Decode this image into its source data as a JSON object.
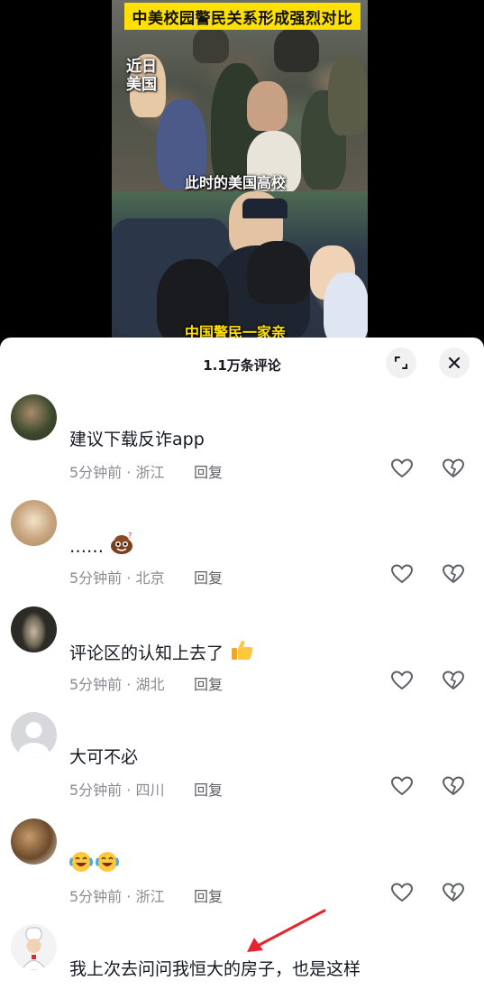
{
  "video": {
    "banner": "中美校园警民关系形成强烈对比",
    "caption_top_left": "近日美国",
    "caption_mid": "此时的美国高校",
    "caption_bottom": "中国警民一家亲"
  },
  "sheet": {
    "title": "1.1万条评论",
    "expand_icon": "expand-icon",
    "close_icon": "close-icon",
    "reply_label": "回复"
  },
  "comments": [
    {
      "text": "建议下载反诈app",
      "meta": "5分钟前 · 浙江"
    },
    {
      "text": "……",
      "meta": "5分钟前 · 北京",
      "emoji": "poop-emoji"
    },
    {
      "text": "评论区的认知上去了",
      "meta": "5分钟前 · 湖北",
      "emoji": "thumbs-up-emoji"
    },
    {
      "text": "大可不必",
      "meta": "5分钟前 · 四川"
    },
    {
      "text": "",
      "meta": "5分钟前 · 浙江",
      "emoji": "laughing-crying-emoji"
    },
    {
      "text": "我上次去问问我恒大的房子，也是这样",
      "meta": ""
    }
  ],
  "colors": {
    "banner": "#ffe000",
    "arrow": "#e5242b",
    "text": "#161823",
    "meta": "#8a8b91"
  }
}
